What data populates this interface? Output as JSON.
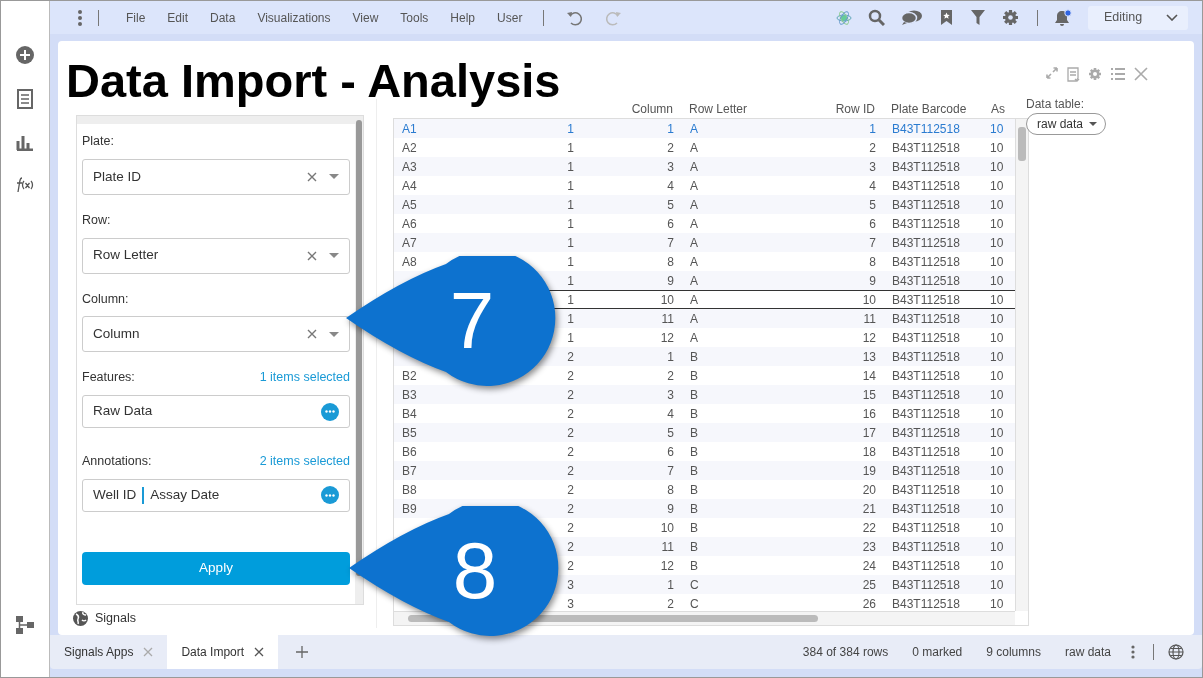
{
  "toolbar": {
    "menus": [
      {
        "label": "File"
      },
      {
        "label": "Edit"
      },
      {
        "label": "Data"
      },
      {
        "label": "Visualizations"
      },
      {
        "label": "View"
      },
      {
        "label": "Tools"
      },
      {
        "label": "Help"
      },
      {
        "label": "User"
      }
    ],
    "undo": {
      "disabled": false
    },
    "redo": {
      "disabled": true
    },
    "notification": true,
    "mode": "Editing"
  },
  "page": {
    "title": "Data Import - Analysis"
  },
  "form": {
    "fields": [
      {
        "kind": "select",
        "label": "Plate:",
        "value": "Plate ID"
      },
      {
        "kind": "select",
        "label": "Row:",
        "value": "Row Letter"
      },
      {
        "kind": "select",
        "label": "Column:",
        "value": "Column"
      },
      {
        "kind": "multi",
        "label": "Features:",
        "count": "1 items selected",
        "values": [
          "Raw Data"
        ]
      },
      {
        "kind": "multi",
        "label": "Annotations:",
        "count": "2 items selected",
        "values": [
          "Well ID",
          "Assay Date"
        ]
      }
    ],
    "apply": "Apply",
    "footer": "Signals"
  },
  "table": {
    "columns": [
      "",
      "",
      "Column",
      "Row Letter",
      "Row ID",
      "Plate Barcode",
      "As"
    ],
    "rows": [
      {
        "cells": [
          "A1",
          "1",
          "1",
          "A",
          "1",
          "B43T112518",
          "10"
        ],
        "focused": true,
        "selected": false
      },
      {
        "cells": [
          "A2",
          "1",
          "2",
          "A",
          "2",
          "B43T112518",
          "10"
        ],
        "focused": false,
        "selected": false
      },
      {
        "cells": [
          "A3",
          "1",
          "3",
          "A",
          "3",
          "B43T112518",
          "10"
        ],
        "focused": false,
        "selected": false
      },
      {
        "cells": [
          "A4",
          "1",
          "4",
          "A",
          "4",
          "B43T112518",
          "10"
        ],
        "focused": false,
        "selected": false
      },
      {
        "cells": [
          "A5",
          "1",
          "5",
          "A",
          "5",
          "B43T112518",
          "10"
        ],
        "focused": false,
        "selected": false
      },
      {
        "cells": [
          "A6",
          "1",
          "6",
          "A",
          "6",
          "B43T112518",
          "10"
        ],
        "focused": false,
        "selected": false
      },
      {
        "cells": [
          "A7",
          "1",
          "7",
          "A",
          "7",
          "B43T112518",
          "10"
        ],
        "focused": false,
        "selected": false
      },
      {
        "cells": [
          "A8",
          "1",
          "8",
          "A",
          "8",
          "B43T112518",
          "10"
        ],
        "focused": false,
        "selected": false
      },
      {
        "cells": [
          null,
          "1",
          "9",
          "A",
          "9",
          "B43T112518",
          "10"
        ],
        "focused": false,
        "selected": false
      },
      {
        "cells": [
          null,
          "1",
          "10",
          "A",
          "10",
          "B43T112518",
          "10"
        ],
        "focused": false,
        "selected": true
      },
      {
        "cells": [
          null,
          "1",
          "11",
          "A",
          "11",
          "B43T112518",
          "10"
        ],
        "focused": false,
        "selected": false
      },
      {
        "cells": [
          null,
          "1",
          "12",
          "A",
          "12",
          "B43T112518",
          "10"
        ],
        "focused": false,
        "selected": false
      },
      {
        "cells": [
          null,
          "2",
          "1",
          "B",
          "13",
          "B43T112518",
          "10"
        ],
        "focused": false,
        "selected": false
      },
      {
        "cells": [
          "B2",
          "2",
          "2",
          "B",
          "14",
          "B43T112518",
          "10"
        ],
        "focused": false,
        "selected": false
      },
      {
        "cells": [
          "B3",
          "2",
          "3",
          "B",
          "15",
          "B43T112518",
          "10"
        ],
        "focused": false,
        "selected": false
      },
      {
        "cells": [
          "B4",
          "2",
          "4",
          "B",
          "16",
          "B43T112518",
          "10"
        ],
        "focused": false,
        "selected": false
      },
      {
        "cells": [
          "B5",
          "2",
          "5",
          "B",
          "17",
          "B43T112518",
          "10"
        ],
        "focused": false,
        "selected": false
      },
      {
        "cells": [
          "B6",
          "2",
          "6",
          "B",
          "18",
          "B43T112518",
          "10"
        ],
        "focused": false,
        "selected": false
      },
      {
        "cells": [
          "B7",
          "2",
          "7",
          "B",
          "19",
          "B43T112518",
          "10"
        ],
        "focused": false,
        "selected": false
      },
      {
        "cells": [
          "B8",
          "2",
          "8",
          "B",
          "20",
          "B43T112518",
          "10"
        ],
        "focused": false,
        "selected": false
      },
      {
        "cells": [
          "B9",
          "2",
          "9",
          "B",
          "21",
          "B43T112518",
          "10"
        ],
        "focused": false,
        "selected": false
      },
      {
        "cells": [
          null,
          "2",
          "10",
          "B",
          "22",
          "B43T112518",
          "10"
        ],
        "focused": false,
        "selected": false
      },
      {
        "cells": [
          null,
          "2",
          "11",
          "B",
          "23",
          "B43T112518",
          "10"
        ],
        "focused": false,
        "selected": false
      },
      {
        "cells": [
          null,
          "2",
          "12",
          "B",
          "24",
          "B43T112518",
          "10"
        ],
        "focused": false,
        "selected": false
      },
      {
        "cells": [
          null,
          "3",
          "1",
          "C",
          "25",
          "B43T112518",
          "10"
        ],
        "focused": false,
        "selected": false
      },
      {
        "cells": [
          null,
          "3",
          "2",
          "C",
          "26",
          "B43T112518",
          "10"
        ],
        "focused": false,
        "selected": false
      }
    ]
  },
  "data_table": {
    "label": "Data table:",
    "value": "raw data"
  },
  "tabs": [
    {
      "label": "Signals Apps",
      "selected": false
    },
    {
      "label": "Data Import",
      "selected": true
    }
  ],
  "status": [
    "384 of 384 rows",
    "0 marked",
    "9 columns",
    "raw data"
  ],
  "callouts": [
    {
      "label": "7"
    },
    {
      "label": "8"
    }
  ]
}
